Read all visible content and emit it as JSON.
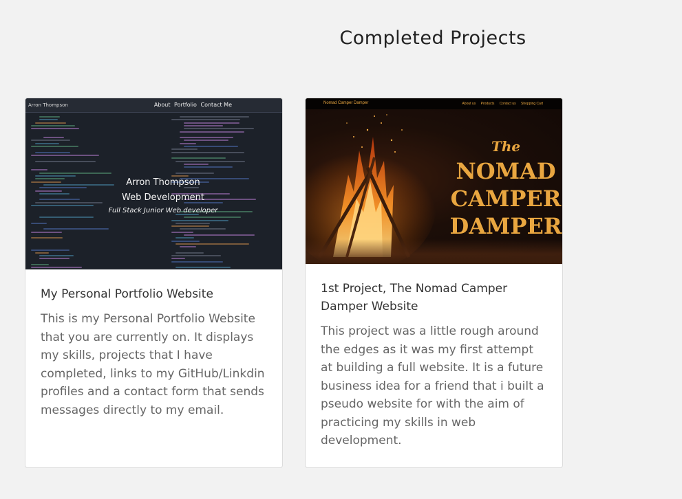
{
  "section": {
    "title": "Completed Projects"
  },
  "projects": [
    {
      "title": "My Personal Portfolio Website",
      "description": "This is my Personal Portfolio Website that you are currently on. It displays my skills, projects that I have completed, links to my GitHub/Linkdin profiles and a contact form that sends messages directly to my email.",
      "thumbnail": {
        "brand": "Arron Thompson",
        "nav": [
          "About",
          "Portfolio",
          "Contact Me"
        ],
        "name": "Arron Thompson",
        "role": "Web Development",
        "tagline": "Full Stack Junior Web developer"
      }
    },
    {
      "title": "1st Project, The Nomad Camper Damper Website",
      "description": "This project was a little rough around the edges as it was my first attempt at building a full website. It is a future business idea for a friend that i built a pseudo website for with the aim of practicing my skills in web development.",
      "thumbnail": {
        "brand": "Nomad Camper Damper",
        "nav": [
          "About us",
          "Products",
          "Contact us",
          "Shopping Cart"
        ],
        "the": "The",
        "title_lines": [
          "NOMAD",
          "CAMPER",
          "DAMPER"
        ]
      }
    }
  ],
  "colors": {
    "page_bg": "#f2f2f2",
    "card_bg": "#ffffff",
    "title_text": "#333333",
    "body_text": "#666666",
    "nomad_accent": "#e9a640"
  }
}
